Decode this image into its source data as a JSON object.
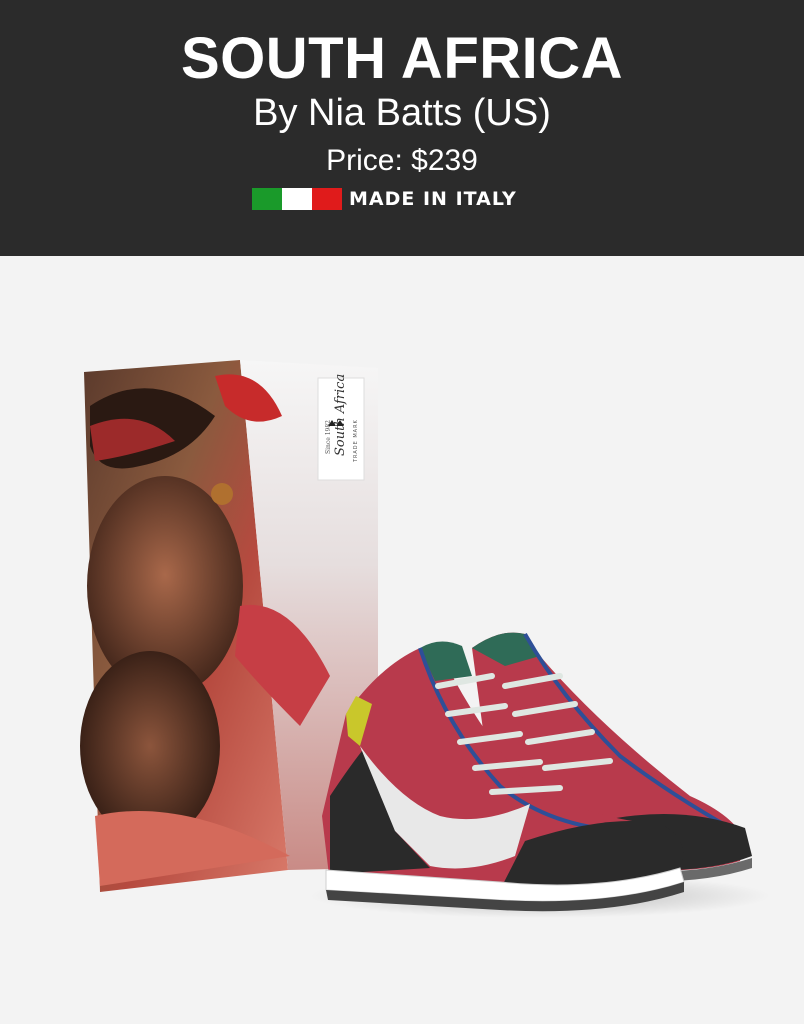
{
  "header": {
    "title": "SOUTH AFRICA",
    "byline": "By Nia Batts (US)",
    "price": "Price: $239",
    "made_in": "MADE IN ITALY",
    "flag_colors": [
      "#1a9a2a",
      "#ffffff",
      "#e01b1b"
    ]
  },
  "product_image": {
    "box_label": "South Africa",
    "box_label_small": "Since 1982",
    "box_trademark": "TRADE MARK"
  },
  "colors": {
    "header_bg": "#2b2b2b",
    "page_bg": "#f3f3f3",
    "shoe_red": "#b83a4c",
    "shoe_green": "#2f6b57",
    "shoe_blue": "#2e4f97",
    "shoe_black": "#2a2a2a"
  }
}
